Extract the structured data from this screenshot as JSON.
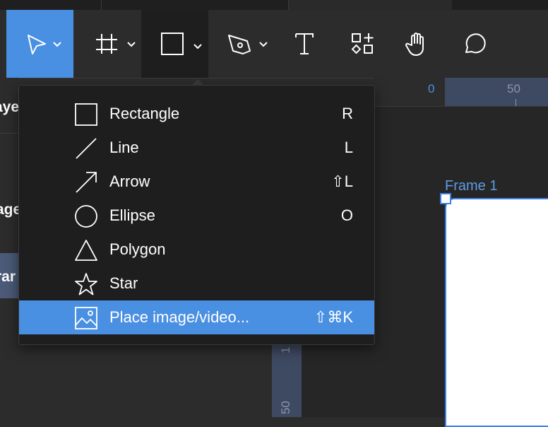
{
  "toolbar": {
    "tools": [
      {
        "name": "move",
        "icon": "cursor-arrow-icon",
        "has_dropdown": true,
        "active": true
      },
      {
        "name": "frame",
        "icon": "frame-hash-icon",
        "has_dropdown": true
      },
      {
        "name": "shape",
        "icon": "square-icon",
        "has_dropdown": true,
        "open": true
      },
      {
        "name": "pen",
        "icon": "pen-nib-icon",
        "has_dropdown": true
      },
      {
        "name": "text",
        "icon": "text-t-icon",
        "has_dropdown": false
      },
      {
        "name": "resources",
        "icon": "shapes-grid-icon",
        "has_dropdown": false
      },
      {
        "name": "hand",
        "icon": "hand-icon",
        "has_dropdown": false
      },
      {
        "name": "comment",
        "icon": "speech-bubble-icon",
        "has_dropdown": false
      }
    ]
  },
  "left_panel": {
    "layers_label": "aye",
    "row1_label": "",
    "pages_label": "age",
    "selected_label": "rar"
  },
  "ruler": {
    "h_zero": "0",
    "h_fifty": "50",
    "v_one": "1",
    "v_fifty": "50"
  },
  "canvas": {
    "frame_label": "Frame 1"
  },
  "menu": {
    "items": [
      {
        "label": "Rectangle",
        "shortcut": "R",
        "icon": "rectangle-icon"
      },
      {
        "label": "Line",
        "shortcut": "L",
        "icon": "line-icon"
      },
      {
        "label": "Arrow",
        "shortcut": "⇧L",
        "icon": "arrow-icon"
      },
      {
        "label": "Ellipse",
        "shortcut": "O",
        "icon": "ellipse-icon"
      },
      {
        "label": "Polygon",
        "shortcut": "",
        "icon": "polygon-icon"
      },
      {
        "label": "Star",
        "shortcut": "",
        "icon": "star-icon"
      },
      {
        "label": "Place image/video...",
        "shortcut": "⇧⌘K",
        "icon": "image-icon",
        "highlighted": true
      }
    ]
  },
  "colors": {
    "accent": "#4a90e2",
    "menu_bg": "#1e1e1e",
    "toolbar_bg": "#2c2c2c",
    "ruler_band": "#3e4962"
  }
}
